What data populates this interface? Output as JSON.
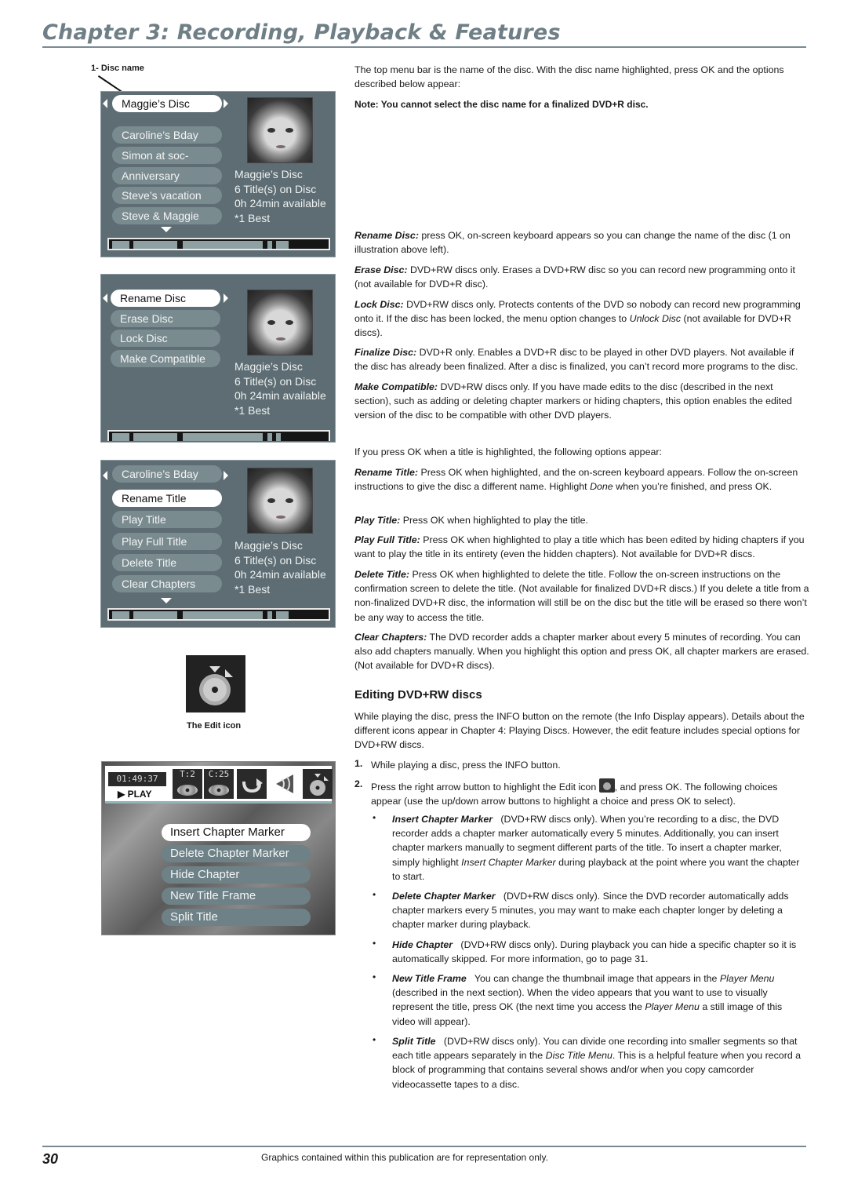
{
  "header": {
    "chapter_title": "Chapter 3: Recording, Playback & Features"
  },
  "left": {
    "callout_label": "1- Disc name",
    "disc_menu": {
      "selected": "Maggie’s Disc",
      "titles": [
        "Caroline’s Bday",
        "Simon at soc-",
        "Anniversary",
        "Steve’s vacation",
        "Steve & Maggie"
      ],
      "info": [
        "Maggie’s Disc",
        "6 Title(s) on Disc",
        "0h 24min available",
        "*1 Best"
      ]
    },
    "disc_options_menu": {
      "items": [
        "Rename Disc",
        "Erase Disc",
        "Lock Disc",
        "Make Compatible"
      ],
      "selected_index": 0,
      "info": [
        "Maggie’s Disc",
        "6 Title(s) on Disc",
        "0h 24min available",
        "*1 Best"
      ]
    },
    "title_options_menu": {
      "header": "Caroline’s Bday",
      "items": [
        "Rename Title",
        "Play Title",
        "Play Full Title",
        "Delete Title",
        "Clear Chapters"
      ],
      "selected_index": 0,
      "info": [
        "Maggie’s Disc",
        "6 Title(s) on Disc",
        "0h 24min available",
        "*1 Best"
      ]
    },
    "edit_icon_caption": "The Edit icon",
    "info_display": {
      "time": "01:49:37",
      "status": "▶ PLAY",
      "title_badge": "T:2",
      "chapter_badge": "C:25",
      "icons": [
        "repeat-icon",
        "audio-icon",
        "edit-icon"
      ],
      "edit_menu": [
        "Insert Chapter Marker",
        "Delete Chapter Marker",
        "Hide Chapter",
        "New Title Frame",
        "Split Title"
      ],
      "selected_index": 0
    }
  },
  "right": {
    "intro": "The top menu bar is the name of the disc. With the disc name highlighted, press OK and the options described below appear:",
    "note": "Note: You cannot select the disc name for a finalized DVD+R disc.",
    "disc_options": [
      {
        "term": "Rename Disc:",
        "text": " press OK, on-screen keyboard appears so you can change the name of the disc (1 on illustration above left)."
      },
      {
        "term": "Erase Disc:",
        "text": " DVD+RW discs only. Erases a DVD+RW disc so you can record new programming onto it (not available for DVD+R disc)."
      },
      {
        "term": "Lock Disc:",
        "text": " DVD+RW discs only. Protects contents of the DVD so nobody can record new programming onto it. If the disc has been locked, the menu option changes to ",
        "italic": "Unlock Disc",
        "text2": " (not available for DVD+R discs)."
      },
      {
        "term": "Finalize Disc:",
        "text": " DVD+R only. Enables a DVD+R disc to be played in other DVD players. Not available if the disc has already been finalized. After a disc is finalized, you can’t record more programs to the disc."
      },
      {
        "term": "Make Compatible:",
        "text": " DVD+RW discs only. If you have made edits to the disc (described in the next section), such as adding or deleting chapter markers or hiding chapters, this option enables the edited version of the disc to be compatible with other DVD players."
      }
    ],
    "title_intro": "If you press OK when a title is highlighted, the following options appear:",
    "title_options": [
      {
        "term": "Rename Title:",
        "text": " Press OK when highlighted, and the on-screen keyboard appears. Follow the on-screen instructions to give the disc a different name. Highlight ",
        "italic": "Done",
        "text2": " when you’re finished, and press OK."
      },
      {
        "term": "Play Title:",
        "text": " Press OK when highlighted to play the title."
      },
      {
        "term": "Play Full Title:",
        "text": " Press OK when highlighted to play a title which has been edited by hiding chapters if you want to play the title in its entirety (even the hidden chapters). Not available for DVD+R discs."
      },
      {
        "term": "Delete Title:",
        "text": " Press OK when highlighted to delete the title. Follow the on-screen instructions on the confirmation screen to delete the title. (Not available for finalized DVD+R discs.) If you delete a title from a non-finalized DVD+R disc, the information will still be on the disc but the title will be erased so there won’t be any way to access the title."
      },
      {
        "term": "Clear Chapters:",
        "text": " The DVD recorder adds a chapter marker about every 5 minutes of recording. You can also add chapters manually. When you highlight this option and press OK, all chapter markers are erased. (Not available for DVD+R discs)."
      }
    ],
    "editing_heading": "Editing DVD+RW discs",
    "editing_intro": "While playing the disc, press the INFO button on the remote (the Info Display appears). Details about the different icons appear in Chapter 4: Playing Discs. However, the edit feature includes special options for DVD+RW discs.",
    "steps": [
      {
        "num": "1.",
        "text": "While playing a disc, press the INFO button."
      },
      {
        "num": "2.",
        "text_a": "Press the right arrow button to highlight the Edit icon ",
        "text_b": ", and press OK. The following choices appear (use the up/down arrow buttons to highlight a choice and press OK to select)."
      }
    ],
    "bullets": [
      {
        "term": "Insert Chapter Marker",
        "text": "   (DVD+RW discs only). When you’re recording to a disc, the DVD recorder adds a chapter marker automatically every 5 minutes. Additionally, you can insert chapter markers manually to segment different parts of the title. To insert a chapter marker, simply highlight ",
        "italic": "Insert Chapter Marker",
        "text2": " during playback at the point where you want the chapter to start."
      },
      {
        "term": "Delete Chapter Marker",
        "text": "   (DVD+RW discs only). Since the DVD recorder automatically adds chapter markers every 5 minutes, you may want to make each chapter longer by deleting a chapter marker during playback."
      },
      {
        "term": "Hide Chapter",
        "text": "   (DVD+RW discs only). During playback you can hide a specific chapter so it is automatically skipped. For more information, go to page 31."
      },
      {
        "term": "New Title Frame",
        "text": "   You can change the thumbnail image that appears in the ",
        "italic": "Player Menu",
        "text2": " (described in the next section). When the video appears that you want to use to visually represent the title, press OK (the next time you access the ",
        "italic2": "Player Menu",
        "text3": " a still image of this video will appear)."
      },
      {
        "term": "Split Title",
        "text": "   (DVD+RW discs only). You can divide one recording into smaller segments so that each title appears separately in the ",
        "italic": "Disc Title Menu",
        "text2": ". This is a helpful feature when you record a block of programming that contains several shows and/or when you copy camcorder videocassette tapes to a disc."
      }
    ]
  },
  "footer": {
    "page_number": "30",
    "disclaimer": "Graphics contained within this publication are for representation only."
  }
}
